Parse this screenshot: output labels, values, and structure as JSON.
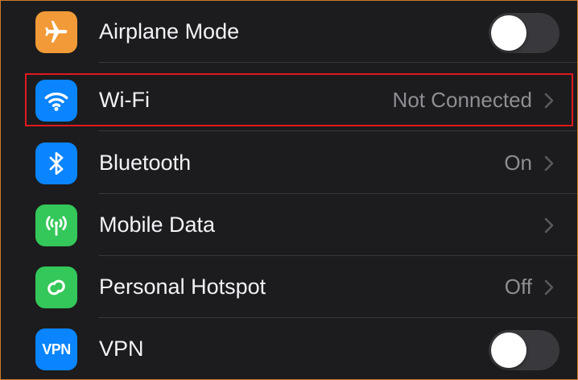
{
  "settings": {
    "rows": [
      {
        "label": "Airplane Mode",
        "icon": "airplane-icon",
        "icon_color": "#f19a37",
        "control": "toggle",
        "toggle_on": false
      },
      {
        "label": "Wi-Fi",
        "icon": "wifi-icon",
        "icon_color": "#0a84ff",
        "value": "Not Connected",
        "control": "chevron",
        "highlighted": true
      },
      {
        "label": "Bluetooth",
        "icon": "bluetooth-icon",
        "icon_color": "#0a84ff",
        "value": "On",
        "control": "chevron"
      },
      {
        "label": "Mobile Data",
        "icon": "antenna-icon",
        "icon_color": "#34c759",
        "value": "",
        "control": "chevron"
      },
      {
        "label": "Personal Hotspot",
        "icon": "hotspot-icon",
        "icon_color": "#34c759",
        "value": "Off",
        "control": "chevron"
      },
      {
        "label": "VPN",
        "icon": "vpn-icon",
        "icon_color": "#0a84ff",
        "icon_text": "VPN",
        "control": "toggle",
        "toggle_on": false
      }
    ]
  },
  "colors": {
    "background": "#1c1c1e",
    "highlight_border": "#e0191e",
    "toggle_off": "#39393d"
  }
}
